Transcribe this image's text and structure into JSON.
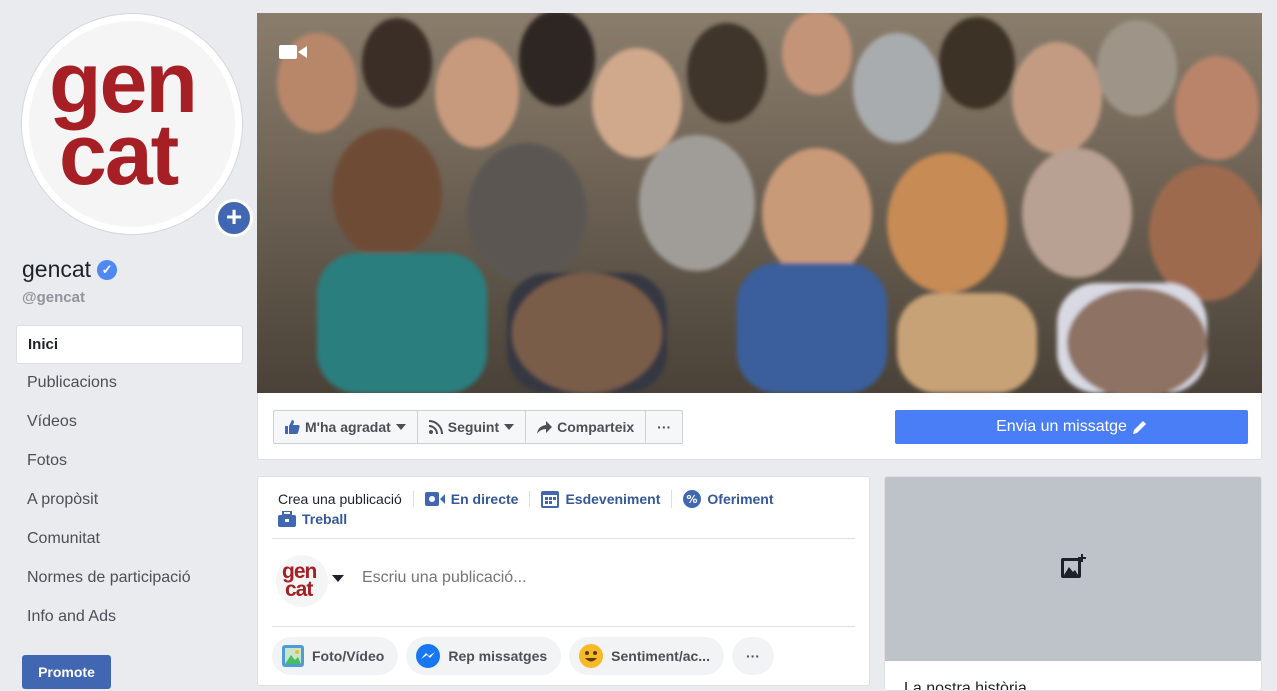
{
  "colors": {
    "primary": "#4267b2",
    "accent": "#4a7ef6",
    "brand_red": "#a51f24",
    "background": "#e9ebee"
  },
  "profile": {
    "logo_line1": "gen",
    "logo_line2": "cat",
    "name": "gencat",
    "handle": "@gencat",
    "verified_icon": "check-icon",
    "add_icon": "plus-icon"
  },
  "nav": {
    "items": [
      {
        "label": "Inici",
        "active": true
      },
      {
        "label": "Publicacions"
      },
      {
        "label": "Vídeos"
      },
      {
        "label": "Fotos"
      },
      {
        "label": "A propòsit"
      },
      {
        "label": "Comunitat"
      },
      {
        "label": "Normes de participació"
      },
      {
        "label": "Info and Ads"
      }
    ],
    "promote_label": "Promote"
  },
  "actions": {
    "like_label": "M'ha agradat",
    "follow_label": "Seguint",
    "share_label": "Comparteix",
    "more_label": "···",
    "send_message_label": "Envia un missatge"
  },
  "composer": {
    "tabs": [
      "Crea una publicació",
      "En directe",
      "Esdeveniment",
      "Oferiment"
    ],
    "tab_job": "Treball",
    "placeholder": "Escriu una publicació...",
    "pills": [
      "Foto/Vídeo",
      "Rep missatges",
      "Sentiment/ac..."
    ],
    "more_label": "···"
  },
  "story": {
    "title": "La nostra història"
  }
}
